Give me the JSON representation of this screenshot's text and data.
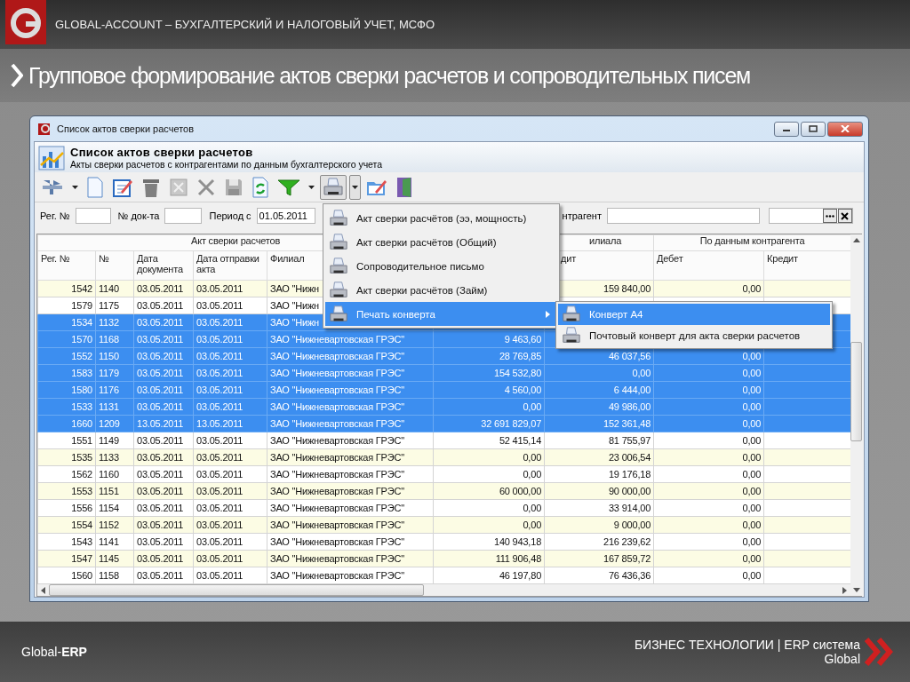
{
  "slide": {
    "header": "GLOBAL-ACCOUNT – БУХГАЛТЕРСКИЙ И НАЛОГОВЫЙ УЧЕТ, МСФО",
    "title": "Групповое формирование актов сверки расчетов и сопроводительных писем"
  },
  "window": {
    "title": "Список актов сверки расчетов",
    "heading": "Список актов сверки расчетов",
    "subheading": "Акты сверки расчетов с контрагентами по данным бухгалтерского учета"
  },
  "toolbar": [
    {
      "kind": "tools",
      "dropdown": true,
      "pressed": false
    },
    {
      "kind": "new",
      "dropdown": false,
      "pressed": false
    },
    {
      "kind": "edit",
      "dropdown": false,
      "pressed": false
    },
    {
      "kind": "delete",
      "dropdown": false,
      "pressed": false
    },
    {
      "kind": "cancel",
      "dropdown": false,
      "pressed": false
    },
    {
      "kind": "close",
      "dropdown": false,
      "pressed": false
    },
    {
      "kind": "save",
      "dropdown": false,
      "pressed": false
    },
    {
      "kind": "refresh",
      "dropdown": false,
      "pressed": false
    },
    {
      "kind": "filter",
      "dropdown": true,
      "pressed": false
    },
    {
      "kind": "print",
      "dropdown": true,
      "pressed": true
    },
    {
      "kind": "folder",
      "dropdown": false,
      "pressed": false
    },
    {
      "kind": "exit",
      "dropdown": false,
      "pressed": false
    }
  ],
  "filters": [
    {
      "label": "Рег. №"
    },
    {
      "label": "№ док-та"
    },
    {
      "label": "Период с",
      "value": "01.05.2011"
    },
    {
      "label": "нтрагент"
    }
  ],
  "table": {
    "groups": [
      {
        "label": "Акт сверки расчетов"
      },
      {
        "label": "илиала"
      },
      {
        "label": "По данным контрагента"
      }
    ],
    "columns": [
      "Рег. №",
      "№",
      "Дата документа",
      "Дата отправки акта",
      "Филиал",
      null,
      "дит",
      "Дебет",
      "Кредит"
    ],
    "rows": [
      {
        "selected": false,
        "cells": [
          "1542",
          "1140",
          "03.05.2011",
          "03.05.2011",
          "ЗАО \"Нижн",
          null,
          "159 840,00",
          "0,00"
        ]
      },
      {
        "selected": false,
        "cells": [
          "1579",
          "1175",
          "03.05.2011",
          "03.05.2011",
          "ЗАО \"Нижн"
        ]
      },
      {
        "selected": true,
        "cells": [
          "1534",
          "1132",
          "03.05.2011",
          "03.05.2011",
          "ЗАО \"Нижн"
        ]
      },
      {
        "selected": true,
        "cells": [
          "1570",
          "1168",
          "03.05.2011",
          "03.05.2011",
          "ЗАО \"Нижневартовская ГРЭС\"",
          "9 463,60"
        ]
      },
      {
        "selected": true,
        "cells": [
          "1552",
          "1150",
          "03.05.2011",
          "03.05.2011",
          "ЗАО \"Нижневартовская ГРЭС\"",
          "28 769,85",
          "46 037,56",
          "0,00"
        ]
      },
      {
        "selected": true,
        "cells": [
          "1583",
          "1179",
          "03.05.2011",
          "03.05.2011",
          "ЗАО \"Нижневартовская ГРЭС\"",
          "154 532,80",
          "0,00",
          "0,00"
        ]
      },
      {
        "selected": true,
        "cells": [
          "1580",
          "1176",
          "03.05.2011",
          "03.05.2011",
          "ЗАО \"Нижневартовская ГРЭС\"",
          "4 560,00",
          "6 444,00",
          "0,00"
        ]
      },
      {
        "selected": true,
        "cells": [
          "1533",
          "1131",
          "03.05.2011",
          "03.05.2011",
          "ЗАО \"Нижневартовская ГРЭС\"",
          "0,00",
          "49 986,00",
          "0,00"
        ]
      },
      {
        "selected": true,
        "cells": [
          "1660",
          "1209",
          "13.05.2011",
          "13.05.2011",
          "ЗАО \"Нижневартовская ГРЭС\"",
          "32 691 829,07",
          "152 361,48",
          "0,00"
        ]
      },
      {
        "selected": false,
        "cells": [
          "1551",
          "1149",
          "03.05.2011",
          "03.05.2011",
          "ЗАО \"Нижневартовская ГРЭС\"",
          "52 415,14",
          "81 755,97",
          "0,00"
        ]
      },
      {
        "selected": false,
        "cells": [
          "1535",
          "1133",
          "03.05.2011",
          "03.05.2011",
          "ЗАО \"Нижневартовская ГРЭС\"",
          "0,00",
          "23 006,54",
          "0,00"
        ]
      },
      {
        "selected": false,
        "cells": [
          "1562",
          "1160",
          "03.05.2011",
          "03.05.2011",
          "ЗАО \"Нижневартовская ГРЭС\"",
          "0,00",
          "19 176,18",
          "0,00"
        ]
      },
      {
        "selected": false,
        "cells": [
          "1553",
          "1151",
          "03.05.2011",
          "03.05.2011",
          "ЗАО \"Нижневартовская ГРЭС\"",
          "60 000,00",
          "90 000,00",
          "0,00"
        ]
      },
      {
        "selected": false,
        "cells": [
          "1556",
          "1154",
          "03.05.2011",
          "03.05.2011",
          "ЗАО \"Нижневартовская ГРЭС\"",
          "0,00",
          "33 914,00",
          "0,00"
        ]
      },
      {
        "selected": false,
        "cells": [
          "1554",
          "1152",
          "03.05.2011",
          "03.05.2011",
          "ЗАО \"Нижневартовская ГРЭС\"",
          "0,00",
          "9 000,00",
          "0,00"
        ]
      },
      {
        "selected": false,
        "cells": [
          "1543",
          "1141",
          "03.05.2011",
          "03.05.2011",
          "ЗАО \"Нижневартовская ГРЭС\"",
          "140 943,18",
          "216 239,62",
          "0,00"
        ]
      },
      {
        "selected": false,
        "cells": [
          "1547",
          "1145",
          "03.05.2011",
          "03.05.2011",
          "ЗАО \"Нижневартовская ГРЭС\"",
          "111 906,48",
          "167 859,72",
          "0,00"
        ]
      },
      {
        "selected": false,
        "cells": [
          "1560",
          "1158",
          "03.05.2011",
          "03.05.2011",
          "ЗАО \"Нижневартовская ГРЭС\"",
          "46 197,80",
          "76 436,36",
          "0,00"
        ]
      }
    ]
  },
  "menu": {
    "items": [
      {
        "label": "Акт сверки расчётов (ээ, мощность)",
        "selected": false
      },
      {
        "label": "Акт сверки расчётов (Общий)",
        "selected": false
      },
      {
        "label": "Сопроводительное письмо",
        "selected": false
      },
      {
        "label": "Акт сверки расчётов (Займ)",
        "selected": false
      },
      {
        "label": "Печать конверта",
        "selected": true,
        "submenu": [
          {
            "label": "Конверт А4",
            "selected": true
          },
          {
            "label": "Почтовый конверт для акта сверки расчетов",
            "selected": false
          }
        ]
      }
    ]
  },
  "footer": {
    "brand": "Global-**ERP**",
    "tagline_1": "БИЗНЕС ТЕХНОЛОГИИ | ERP система",
    "tagline_2": "Global"
  }
}
